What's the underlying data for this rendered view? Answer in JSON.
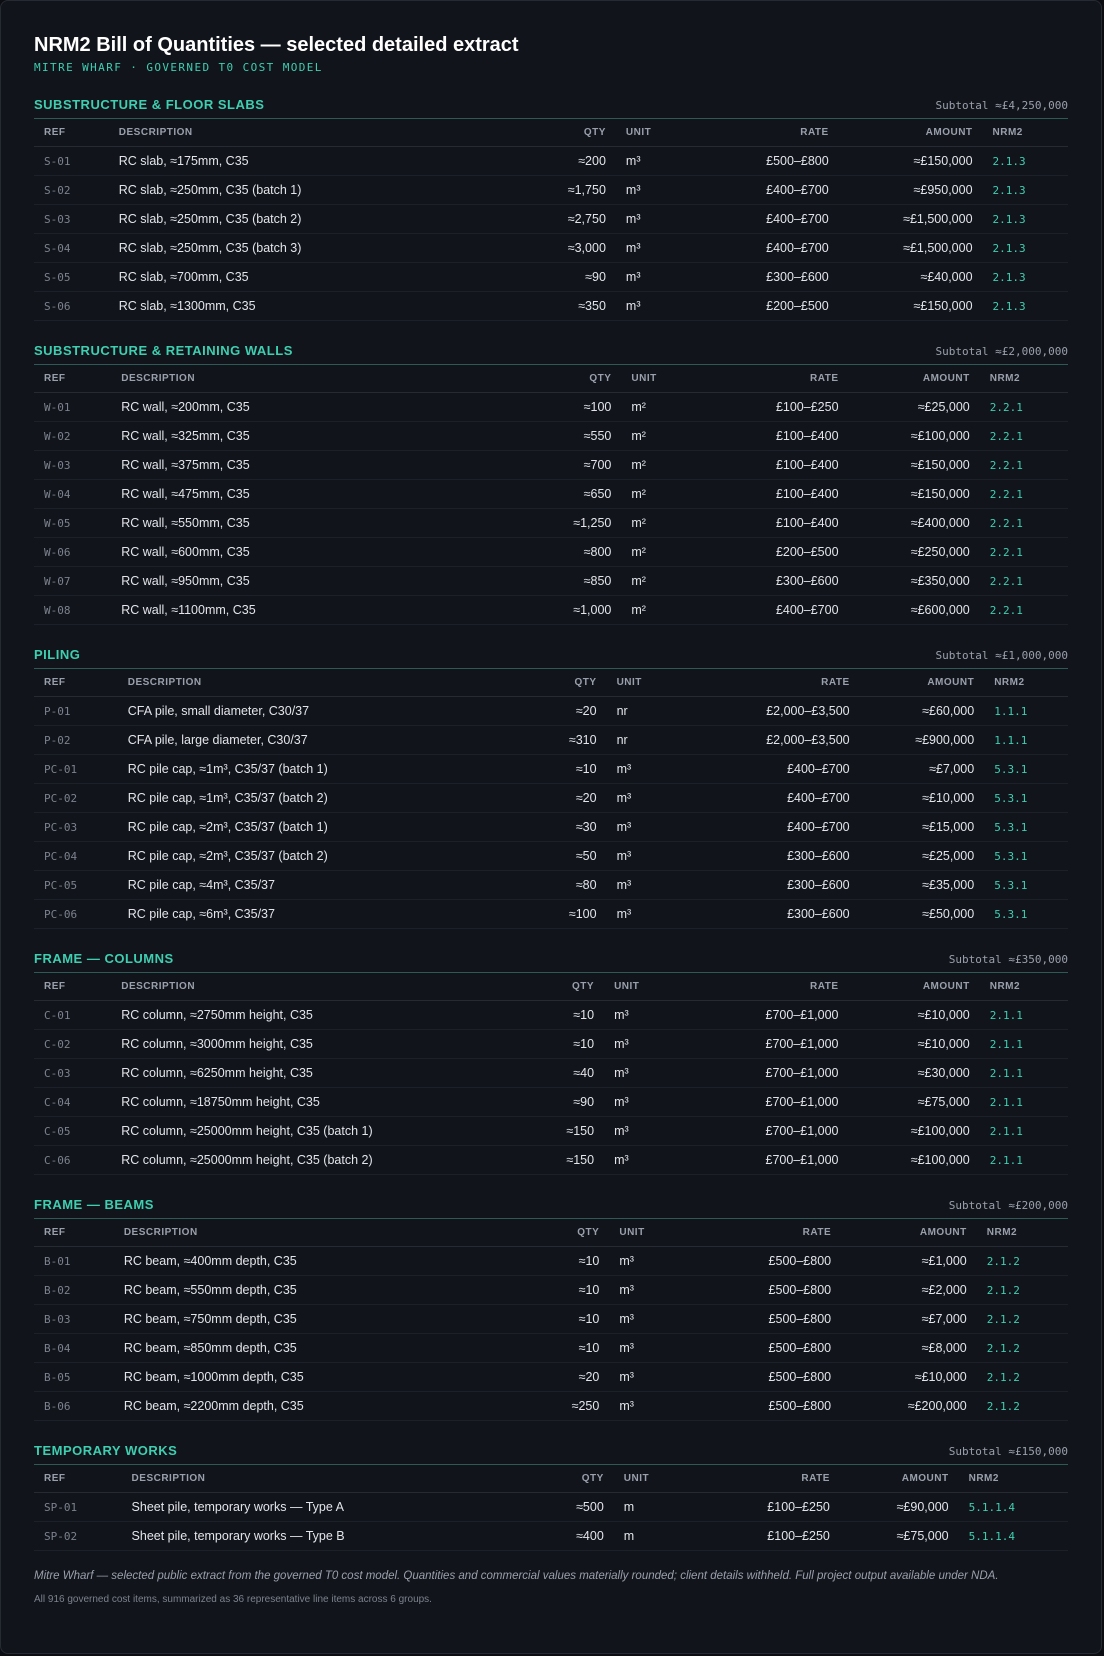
{
  "header": {
    "title": "NRM2 Bill of Quantities — selected detailed extract",
    "subtitle": "MITRE WHARF · GOVERNED T0 COST MODEL"
  },
  "columns": {
    "ref": "REF",
    "description": "DESCRIPTION",
    "qty": "QTY",
    "unit": "UNIT",
    "rate": "RATE",
    "amount": "AMOUNT",
    "nrm2": "NRM2"
  },
  "sections": [
    {
      "title": "SUBSTRUCTURE & FLOOR SLABS",
      "subtotal": "Subtotal ≈£4,250,000",
      "rows": [
        {
          "ref": "S-01",
          "desc": "RC slab, ≈175mm, C35",
          "qty": "≈200",
          "unit": "m³",
          "rate": "£500–£800",
          "amount": "≈£150,000",
          "nrm2": "2.1.3"
        },
        {
          "ref": "S-02",
          "desc": "RC slab, ≈250mm, C35 (batch 1)",
          "qty": "≈1,750",
          "unit": "m³",
          "rate": "£400–£700",
          "amount": "≈£950,000",
          "nrm2": "2.1.3"
        },
        {
          "ref": "S-03",
          "desc": "RC slab, ≈250mm, C35 (batch 2)",
          "qty": "≈2,750",
          "unit": "m³",
          "rate": "£400–£700",
          "amount": "≈£1,500,000",
          "nrm2": "2.1.3"
        },
        {
          "ref": "S-04",
          "desc": "RC slab, ≈250mm, C35 (batch 3)",
          "qty": "≈3,000",
          "unit": "m³",
          "rate": "£400–£700",
          "amount": "≈£1,500,000",
          "nrm2": "2.1.3"
        },
        {
          "ref": "S-05",
          "desc": "RC slab, ≈700mm, C35",
          "qty": "≈90",
          "unit": "m³",
          "rate": "£300–£600",
          "amount": "≈£40,000",
          "nrm2": "2.1.3"
        },
        {
          "ref": "S-06",
          "desc": "RC slab, ≈1300mm, C35",
          "qty": "≈350",
          "unit": "m³",
          "rate": "£200–£500",
          "amount": "≈£150,000",
          "nrm2": "2.1.3"
        }
      ]
    },
    {
      "title": "SUBSTRUCTURE & RETAINING WALLS",
      "subtotal": "Subtotal ≈£2,000,000",
      "rows": [
        {
          "ref": "W-01",
          "desc": "RC wall, ≈200mm, C35",
          "qty": "≈100",
          "unit": "m²",
          "rate": "£100–£250",
          "amount": "≈£25,000",
          "nrm2": "2.2.1"
        },
        {
          "ref": "W-02",
          "desc": "RC wall, ≈325mm, C35",
          "qty": "≈550",
          "unit": "m²",
          "rate": "£100–£400",
          "amount": "≈£100,000",
          "nrm2": "2.2.1"
        },
        {
          "ref": "W-03",
          "desc": "RC wall, ≈375mm, C35",
          "qty": "≈700",
          "unit": "m²",
          "rate": "£100–£400",
          "amount": "≈£150,000",
          "nrm2": "2.2.1"
        },
        {
          "ref": "W-04",
          "desc": "RC wall, ≈475mm, C35",
          "qty": "≈650",
          "unit": "m²",
          "rate": "£100–£400",
          "amount": "≈£150,000",
          "nrm2": "2.2.1"
        },
        {
          "ref": "W-05",
          "desc": "RC wall, ≈550mm, C35",
          "qty": "≈1,250",
          "unit": "m²",
          "rate": "£100–£400",
          "amount": "≈£400,000",
          "nrm2": "2.2.1"
        },
        {
          "ref": "W-06",
          "desc": "RC wall, ≈600mm, C35",
          "qty": "≈800",
          "unit": "m²",
          "rate": "£200–£500",
          "amount": "≈£250,000",
          "nrm2": "2.2.1"
        },
        {
          "ref": "W-07",
          "desc": "RC wall, ≈950mm, C35",
          "qty": "≈850",
          "unit": "m²",
          "rate": "£300–£600",
          "amount": "≈£350,000",
          "nrm2": "2.2.1"
        },
        {
          "ref": "W-08",
          "desc": "RC wall, ≈1100mm, C35",
          "qty": "≈1,000",
          "unit": "m²",
          "rate": "£400–£700",
          "amount": "≈£600,000",
          "nrm2": "2.2.1"
        }
      ]
    },
    {
      "title": "PILING",
      "subtotal": "Subtotal ≈£1,000,000",
      "rows": [
        {
          "ref": "P-01",
          "desc": "CFA pile, small diameter, C30/37",
          "qty": "≈20",
          "unit": "nr",
          "rate": "£2,000–£3,500",
          "amount": "≈£60,000",
          "nrm2": "1.1.1"
        },
        {
          "ref": "P-02",
          "desc": "CFA pile, large diameter, C30/37",
          "qty": "≈310",
          "unit": "nr",
          "rate": "£2,000–£3,500",
          "amount": "≈£900,000",
          "nrm2": "1.1.1"
        },
        {
          "ref": "PC-01",
          "desc": "RC pile cap, ≈1m³, C35/37 (batch 1)",
          "qty": "≈10",
          "unit": "m³",
          "rate": "£400–£700",
          "amount": "≈£7,000",
          "nrm2": "5.3.1"
        },
        {
          "ref": "PC-02",
          "desc": "RC pile cap, ≈1m³, C35/37 (batch 2)",
          "qty": "≈20",
          "unit": "m³",
          "rate": "£400–£700",
          "amount": "≈£10,000",
          "nrm2": "5.3.1"
        },
        {
          "ref": "PC-03",
          "desc": "RC pile cap, ≈2m³, C35/37 (batch 1)",
          "qty": "≈30",
          "unit": "m³",
          "rate": "£400–£700",
          "amount": "≈£15,000",
          "nrm2": "5.3.1"
        },
        {
          "ref": "PC-04",
          "desc": "RC pile cap, ≈2m³, C35/37 (batch 2)",
          "qty": "≈50",
          "unit": "m³",
          "rate": "£300–£600",
          "amount": "≈£25,000",
          "nrm2": "5.3.1"
        },
        {
          "ref": "PC-05",
          "desc": "RC pile cap, ≈4m³, C35/37",
          "qty": "≈80",
          "unit": "m³",
          "rate": "£300–£600",
          "amount": "≈£35,000",
          "nrm2": "5.3.1"
        },
        {
          "ref": "PC-06",
          "desc": "RC pile cap, ≈6m³, C35/37",
          "qty": "≈100",
          "unit": "m³",
          "rate": "£300–£600",
          "amount": "≈£50,000",
          "nrm2": "5.3.1"
        }
      ]
    },
    {
      "title": "FRAME — COLUMNS",
      "subtotal": "Subtotal ≈£350,000",
      "rows": [
        {
          "ref": "C-01",
          "desc": "RC column, ≈2750mm height, C35",
          "qty": "≈10",
          "unit": "m³",
          "rate": "£700–£1,000",
          "amount": "≈£10,000",
          "nrm2": "2.1.1"
        },
        {
          "ref": "C-02",
          "desc": "RC column, ≈3000mm height, C35",
          "qty": "≈10",
          "unit": "m³",
          "rate": "£700–£1,000",
          "amount": "≈£10,000",
          "nrm2": "2.1.1"
        },
        {
          "ref": "C-03",
          "desc": "RC column, ≈6250mm height, C35",
          "qty": "≈40",
          "unit": "m³",
          "rate": "£700–£1,000",
          "amount": "≈£30,000",
          "nrm2": "2.1.1"
        },
        {
          "ref": "C-04",
          "desc": "RC column, ≈18750mm height, C35",
          "qty": "≈90",
          "unit": "m³",
          "rate": "£700–£1,000",
          "amount": "≈£75,000",
          "nrm2": "2.1.1"
        },
        {
          "ref": "C-05",
          "desc": "RC column, ≈25000mm height, C35 (batch 1)",
          "qty": "≈150",
          "unit": "m³",
          "rate": "£700–£1,000",
          "amount": "≈£100,000",
          "nrm2": "2.1.1"
        },
        {
          "ref": "C-06",
          "desc": "RC column, ≈25000mm height, C35 (batch 2)",
          "qty": "≈150",
          "unit": "m³",
          "rate": "£700–£1,000",
          "amount": "≈£100,000",
          "nrm2": "2.1.1"
        }
      ]
    },
    {
      "title": "FRAME — BEAMS",
      "subtotal": "Subtotal ≈£200,000",
      "rows": [
        {
          "ref": "B-01",
          "desc": "RC beam, ≈400mm depth, C35",
          "qty": "≈10",
          "unit": "m³",
          "rate": "£500–£800",
          "amount": "≈£1,000",
          "nrm2": "2.1.2"
        },
        {
          "ref": "B-02",
          "desc": "RC beam, ≈550mm depth, C35",
          "qty": "≈10",
          "unit": "m³",
          "rate": "£500–£800",
          "amount": "≈£2,000",
          "nrm2": "2.1.2"
        },
        {
          "ref": "B-03",
          "desc": "RC beam, ≈750mm depth, C35",
          "qty": "≈10",
          "unit": "m³",
          "rate": "£500–£800",
          "amount": "≈£7,000",
          "nrm2": "2.1.2"
        },
        {
          "ref": "B-04",
          "desc": "RC beam, ≈850mm depth, C35",
          "qty": "≈10",
          "unit": "m³",
          "rate": "£500–£800",
          "amount": "≈£8,000",
          "nrm2": "2.1.2"
        },
        {
          "ref": "B-05",
          "desc": "RC beam, ≈1000mm depth, C35",
          "qty": "≈20",
          "unit": "m³",
          "rate": "£500–£800",
          "amount": "≈£10,000",
          "nrm2": "2.1.2"
        },
        {
          "ref": "B-06",
          "desc": "RC beam, ≈2200mm depth, C35",
          "qty": "≈250",
          "unit": "m³",
          "rate": "£500–£800",
          "amount": "≈£200,000",
          "nrm2": "2.1.2"
        }
      ]
    },
    {
      "title": "TEMPORARY WORKS",
      "subtotal": "Subtotal ≈£150,000",
      "rows": [
        {
          "ref": "SP-01",
          "desc": "Sheet pile, temporary works — Type A",
          "qty": "≈500",
          "unit": "m",
          "rate": "£100–£250",
          "amount": "≈£90,000",
          "nrm2": "5.1.1.4"
        },
        {
          "ref": "SP-02",
          "desc": "Sheet pile, temporary works — Type B",
          "qty": "≈400",
          "unit": "m",
          "rate": "£100–£250",
          "amount": "≈£75,000",
          "nrm2": "5.1.1.4"
        }
      ]
    }
  ],
  "footer": {
    "note": "Mitre Wharf — selected public extract from the governed T0 cost model. Quantities and commercial values materially rounded; client details withheld. Full project output available under NDA.",
    "summary": "All 916 governed cost items, summarized as 36 representative line items across 6 groups."
  }
}
